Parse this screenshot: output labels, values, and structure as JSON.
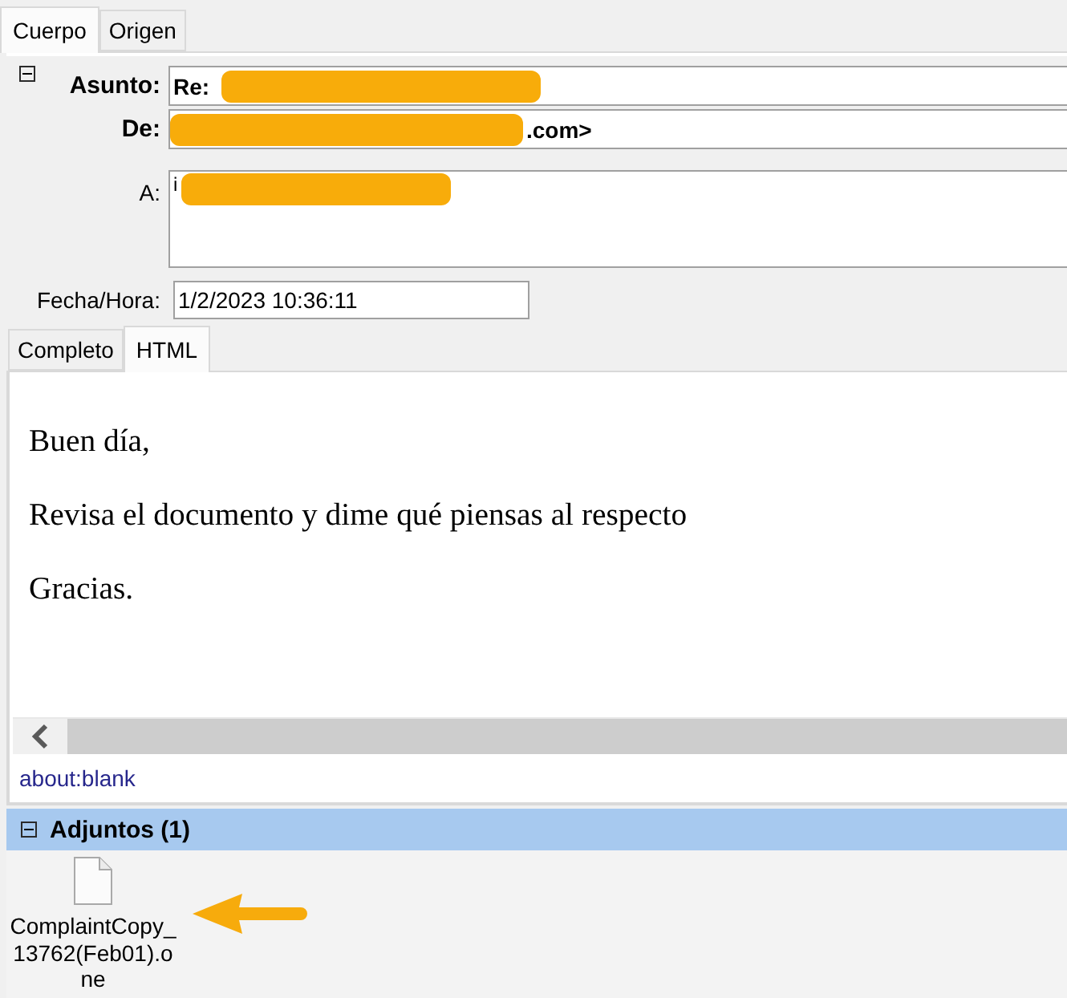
{
  "tabs": [
    {
      "label": "Cuerpo",
      "selected": true
    },
    {
      "label": "Origen",
      "selected": false
    }
  ],
  "header": {
    "expanded": true,
    "fields": [
      {
        "kind": "summary",
        "label": "Asunto:",
        "text": "Re:",
        "masked_before": false,
        "masked_after": true
      },
      {
        "kind": "summary",
        "label": "De:",
        "text": ".com>",
        "masked_before": true,
        "masked_after": false
      },
      {
        "kind": "recipients",
        "label": "A:",
        "text": "i",
        "masked_before": false,
        "masked_after": true
      },
      {
        "kind": "date",
        "label": "Fecha/Hora:",
        "text": "1/2/2023 10:36:11",
        "masked_before": false,
        "masked_after": false
      }
    ]
  },
  "view_tabs": [
    {
      "label": "Completo",
      "selected": false
    },
    {
      "label": "HTML",
      "selected": true
    }
  ],
  "message": {
    "paragraphs": [
      "Buen día,",
      "Revisa el documento y dime qué piensas al respecto",
      "Gracias."
    ]
  },
  "status_bar": {
    "text": "about:blank"
  },
  "attachments": {
    "title": "Adjuntos (1)",
    "expanded": true,
    "files": [
      {
        "name": "ComplaintCopy_13762(Feb01).one",
        "pointed": true
      }
    ]
  }
}
